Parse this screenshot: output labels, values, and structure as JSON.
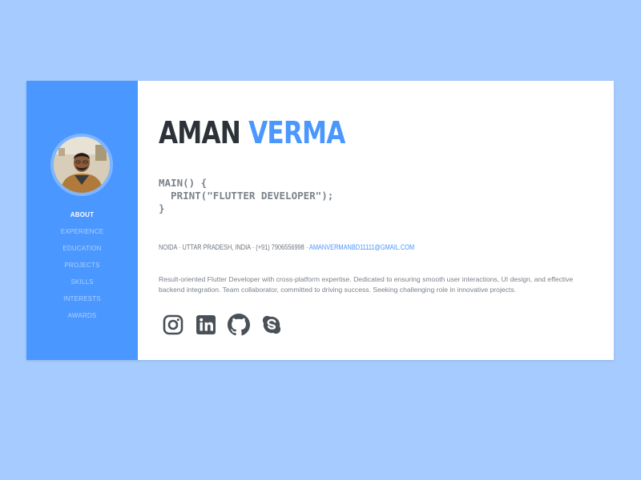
{
  "profile": {
    "first_name": "AMAN",
    "last_name": "VERMA",
    "code_lines": [
      "MAIN() {",
      "  PRINT(\"FLUTTER DEVELOPER\");",
      "}"
    ],
    "location": "NOIDA · UTTAR PRADESH, INDIA · (+91) 7906556998 ·",
    "email": "AMANVERMANBD11111@GMAIL.COM",
    "bio": "Result-oriented Flutter Developer with cross-platform expertise. Dedicated to ensuring smooth user interactions, UI design, and effective backend integration. Team collaborator, committed to driving success. Seeking challenging role in innovative projects."
  },
  "nav": {
    "items": [
      "ABOUT",
      "EXPERIENCE",
      "EDUCATION",
      "PROJECTS",
      "SKILLS",
      "INTERESTS",
      "AWARDS"
    ],
    "active": "ABOUT"
  },
  "socials": {
    "items": [
      "instagram-icon",
      "linkedin-icon",
      "github-icon",
      "skype-icon"
    ]
  },
  "theme": {
    "background": "#a6cbff",
    "sidebar": "#4a97ff",
    "accent": "#4a97ff",
    "heading": "#2d3238",
    "text_muted": "#7b828a",
    "icon": "#495057"
  }
}
